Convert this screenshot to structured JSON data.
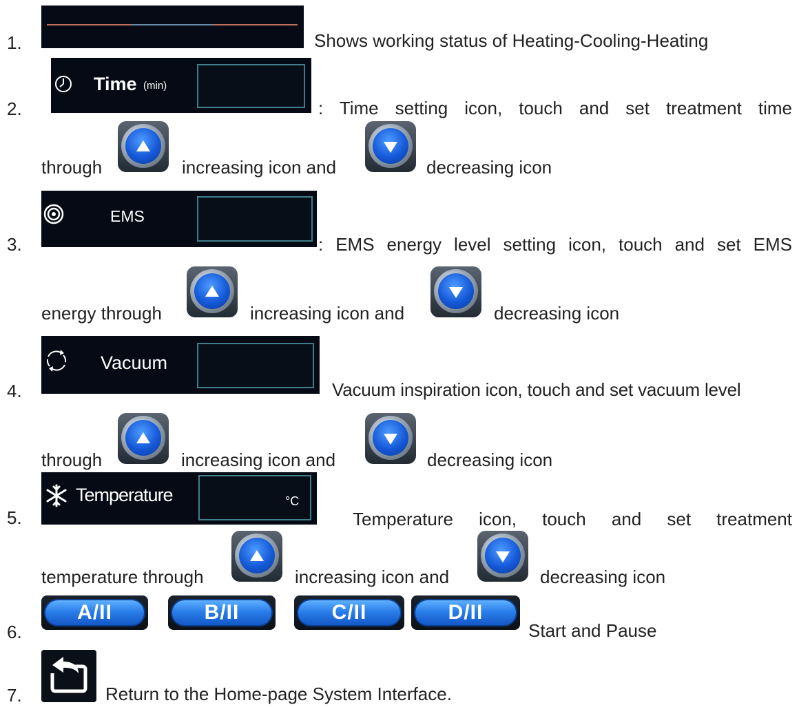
{
  "items": [
    {
      "number": "1.",
      "text": "Shows working status of Heating-Cooling-Heating"
    },
    {
      "number": "2.",
      "label": "Time",
      "unit": "(min)",
      "text": ": Time setting icon, touch and set treatment time",
      "cont_before": "through",
      "mid": "increasing icon and",
      "after": "decreasing icon"
    },
    {
      "number": "3.",
      "label": "EMS",
      "text": ": EMS energy level setting icon, touch and set EMS",
      "cont_before": "energy through",
      "mid": "increasing icon and",
      "after": "decreasing icon"
    },
    {
      "number": "4.",
      "label": "Vacuum",
      "text": "Vacuum inspiration icon, touch and set vacuum level",
      "cont_before": "through",
      "mid": "increasing icon and",
      "after": "decreasing icon"
    },
    {
      "number": "5.",
      "label": "Temperature",
      "unit": "°C",
      "text": "Temperature icon, touch and set treatment",
      "cont_before": "temperature through",
      "mid": "increasing icon and",
      "after": "decreasing icon"
    },
    {
      "number": "6.",
      "buttons": [
        "A/II",
        "B/II",
        "C/II",
        "D/II"
      ],
      "text": "Start and Pause"
    },
    {
      "number": "7.",
      "text": "Return to the Home-page System Interface."
    }
  ],
  "icons": {
    "clock": "clock-icon",
    "target": "target-icon",
    "cycle": "cycle-arrows-icon",
    "snowflake": "snowflake-icon",
    "up": "up-arrow-icon",
    "down": "down-arrow-icon",
    "return": "return-icon"
  },
  "colors": {
    "panel": "#050a14",
    "field_border": "#3f7f8a",
    "button_blue": "#2a7fea",
    "status_line": "#c0705a"
  }
}
